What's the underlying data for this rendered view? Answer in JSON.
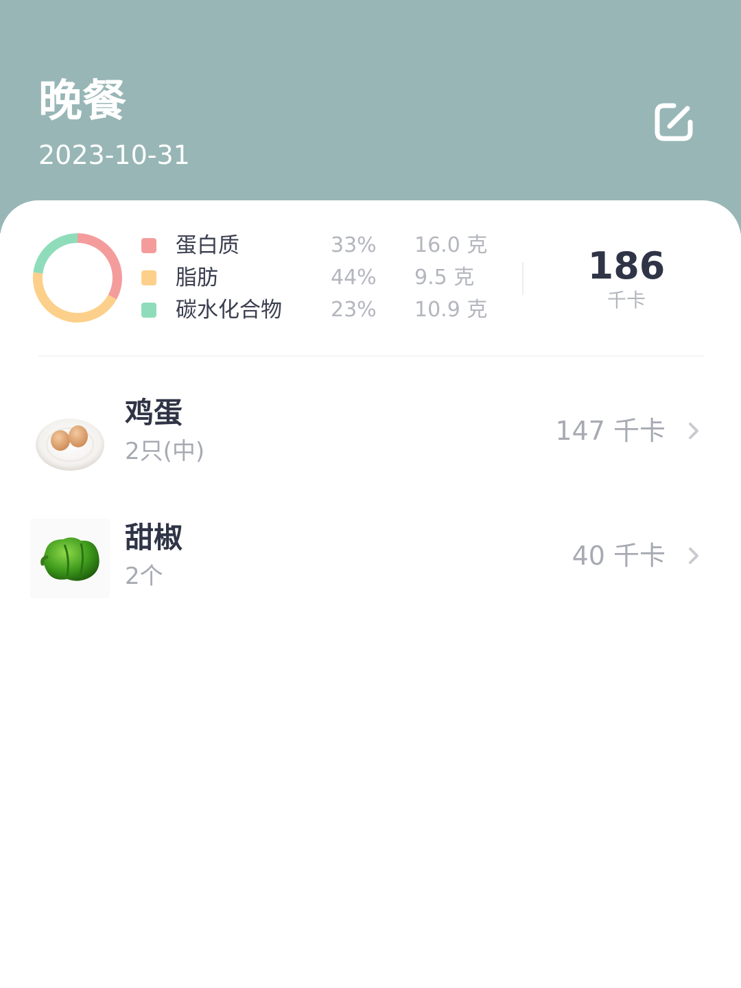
{
  "header": {
    "title": "晚餐",
    "date": "2023-10-31",
    "edit_icon": "edit-square-icon",
    "background": "#98b6b6"
  },
  "summary": {
    "chart_data": {
      "type": "pie",
      "style": "donut",
      "categories": [
        "蛋白质",
        "脂肪",
        "碳水化合物"
      ],
      "values": [
        33,
        44,
        23
      ],
      "colors": [
        "#f49c9c",
        "#fcd08a",
        "#8fdcbb"
      ]
    },
    "macros": [
      {
        "name": "蛋白质",
        "percent": "33%",
        "grams": "16.0 克",
        "color": "#f49c9c"
      },
      {
        "name": "脂肪",
        "percent": "44%",
        "grams": "9.5 克",
        "color": "#fcd08a"
      },
      {
        "name": "碳水化合物",
        "percent": "23%",
        "grams": "10.9 克",
        "color": "#8fdcbb"
      }
    ],
    "total_calories": "186",
    "calorie_unit": "千卡"
  },
  "foods": [
    {
      "name": "鸡蛋",
      "amount": "2只(中)",
      "calories": "147 千卡",
      "image_icon": "eggs-plate-image"
    },
    {
      "name": "甜椒",
      "amount": "2个",
      "calories": "40 千卡",
      "image_icon": "green-pepper-image"
    }
  ]
}
